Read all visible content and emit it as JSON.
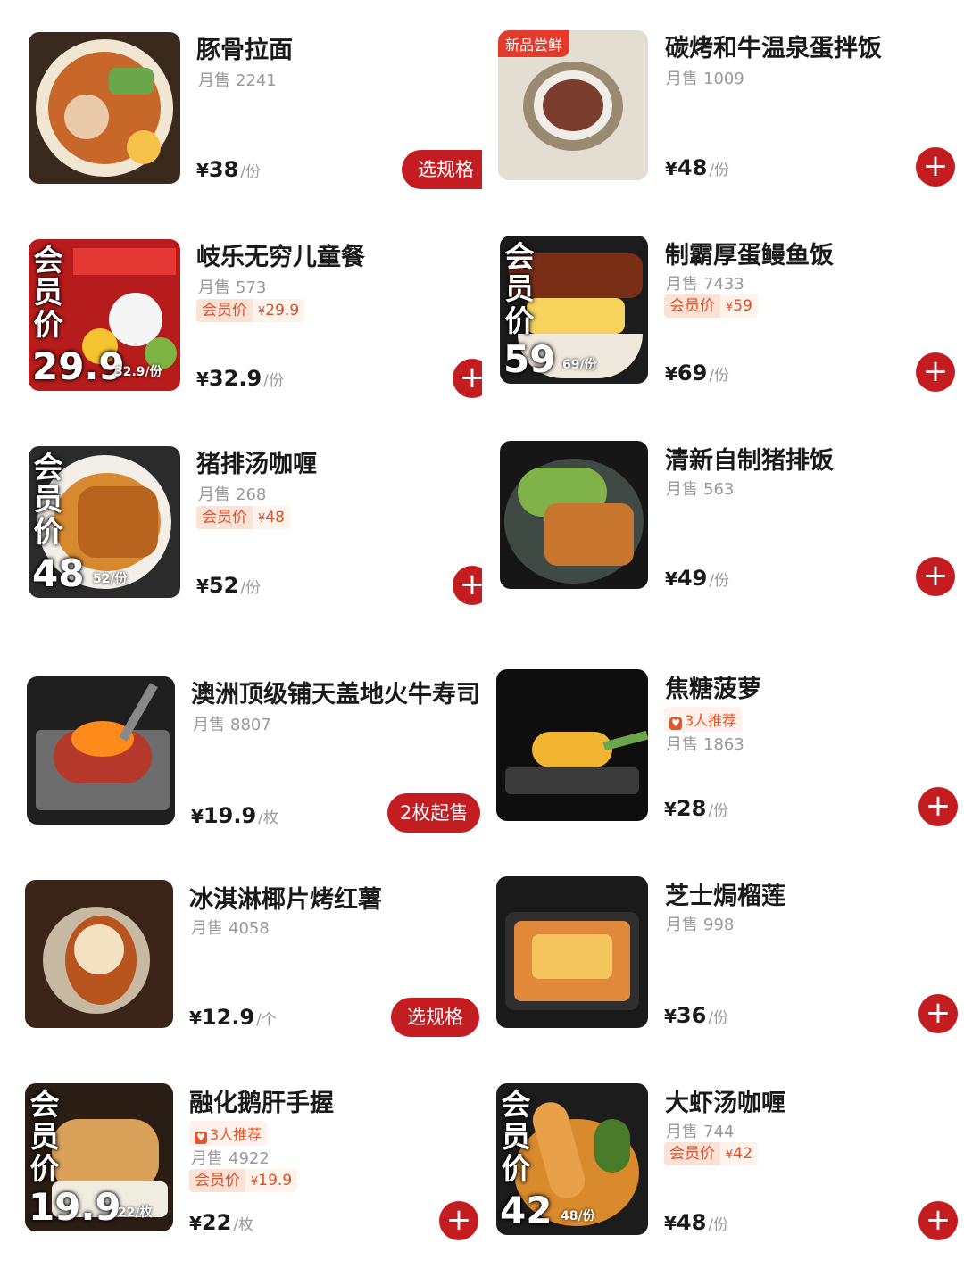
{
  "left": [
    {
      "name": "豚骨拉面",
      "sales_label": "月售",
      "sales": "2241",
      "price_cur": "¥",
      "price": "38",
      "unit": "/份",
      "action": "选规格"
    },
    {
      "name": "岐乐无穷儿童餐",
      "sales_label": "月售",
      "sales": "573",
      "member_label": "会员价",
      "member_cur": "¥",
      "member_price": "29.9",
      "price_cur": "¥",
      "price": "32.9",
      "unit": "/份",
      "action": "+",
      "thumb_member_title": "会员价",
      "thumb_member_big": "29.9",
      "thumb_member_small": "32.9/份"
    },
    {
      "name": "猪排汤咖喱",
      "sales_label": "月售",
      "sales": "268",
      "member_label": "会员价",
      "member_cur": "¥",
      "member_price": "48",
      "price_cur": "¥",
      "price": "52",
      "unit": "/份",
      "action": "+",
      "thumb_member_title": "会员价",
      "thumb_member_big": "48",
      "thumb_member_small": "52/份"
    },
    {
      "name": "澳洲顶级铺天盖地火牛寿司",
      "sales_label": "月售",
      "sales": "8807",
      "price_cur": "¥",
      "price": "19.9",
      "unit": "/枚",
      "action": "2枚起售"
    },
    {
      "name": "冰淇淋椰片烤红薯",
      "sales_label": "月售",
      "sales": "4058",
      "price_cur": "¥",
      "price": "12.9",
      "unit": "/个",
      "action": "选规格"
    },
    {
      "name": "融化鹅肝手握",
      "recommend": "3人推荐",
      "sales_label": "月售",
      "sales": "4922",
      "member_label": "会员价",
      "member_cur": "¥",
      "member_price": "19.9",
      "price_cur": "¥",
      "price": "22",
      "unit": "/枚",
      "action": "+",
      "thumb_member_title": "会员价",
      "thumb_member_big": "19.9",
      "thumb_member_small": "22/枚"
    }
  ],
  "right": [
    {
      "name": "碳烤和牛温泉蛋拌饭",
      "tag": "新品尝鲜",
      "sales_label": "月售",
      "sales": "1009",
      "price_cur": "¥",
      "price": "48",
      "unit": "/份",
      "action": "+"
    },
    {
      "name": "制霸厚蛋鳗鱼饭",
      "sales_label": "月售",
      "sales": "7433",
      "member_label": "会员价",
      "member_cur": "¥",
      "member_price": "59",
      "price_cur": "¥",
      "price": "69",
      "unit": "/份",
      "action": "+",
      "thumb_member_title": "会员价",
      "thumb_member_big": "59",
      "thumb_member_small": "69/份"
    },
    {
      "name": "清新自制猪排饭",
      "sales_label": "月售",
      "sales": "563",
      "price_cur": "¥",
      "price": "49",
      "unit": "/份",
      "action": "+"
    },
    {
      "name": "焦糖菠萝",
      "recommend": "3人推荐",
      "sales_label": "月售",
      "sales": "1863",
      "price_cur": "¥",
      "price": "28",
      "unit": "/份",
      "action": "+"
    },
    {
      "name": "芝士焗榴莲",
      "sales_label": "月售",
      "sales": "998",
      "price_cur": "¥",
      "price": "36",
      "unit": "/份",
      "action": "+"
    },
    {
      "name": "大虾汤咖喱",
      "sales_label": "月售",
      "sales": "744",
      "member_label": "会员价",
      "member_cur": "¥",
      "member_price": "42",
      "price_cur": "¥",
      "price": "48",
      "unit": "/份",
      "action": "+",
      "thumb_member_title": "会员价",
      "thumb_member_big": "42",
      "thumb_member_small": "48/份"
    }
  ],
  "colors": {
    "accent": "#c41d21",
    "member_text": "#d9502a",
    "new_tag": "#e43a2c"
  },
  "icons": {
    "add": "plus-icon",
    "recommend": "recommend-icon"
  }
}
